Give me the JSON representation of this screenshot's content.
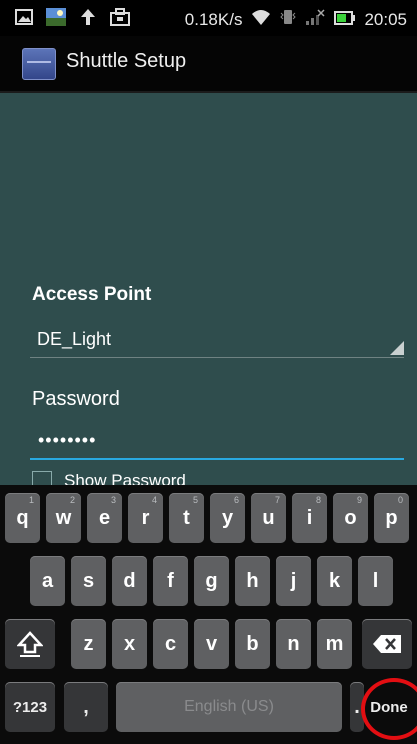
{
  "status_bar": {
    "speed": "0.18K/s",
    "time": "20:05",
    "left_icons": [
      "image-icon",
      "photo-icon",
      "upload-arrow-icon",
      "bag-icon"
    ],
    "right_icons": [
      "wifi-icon",
      "vibrate-icon",
      "signal-icon",
      "battery-icon"
    ]
  },
  "app": {
    "title": "Shuttle Setup",
    "icon": "shuttle-app-icon"
  },
  "form": {
    "access_point_label": "Access Point",
    "access_point_value": "DE_Light",
    "password_label": "Password",
    "password_value": "••••••••",
    "show_password_label": "Show Password",
    "show_password_checked": false
  },
  "keyboard": {
    "row1": [
      {
        "key": "q",
        "hint": "1"
      },
      {
        "key": "w",
        "hint": "2"
      },
      {
        "key": "e",
        "hint": "3"
      },
      {
        "key": "r",
        "hint": "4"
      },
      {
        "key": "t",
        "hint": "5"
      },
      {
        "key": "y",
        "hint": "6"
      },
      {
        "key": "u",
        "hint": "7"
      },
      {
        "key": "i",
        "hint": "8"
      },
      {
        "key": "o",
        "hint": "9"
      },
      {
        "key": "p",
        "hint": "0"
      }
    ],
    "row2": [
      "a",
      "s",
      "d",
      "f",
      "g",
      "h",
      "j",
      "k",
      "l"
    ],
    "row3": [
      "z",
      "x",
      "c",
      "v",
      "b",
      "n",
      "m"
    ],
    "symbols_key": "?123",
    "comma_key": ",",
    "space_label": "English (US)",
    "period_key": ".",
    "done_key": "Done",
    "shift_icon": "shift-arrow-icon",
    "backspace_icon": "backspace-icon"
  },
  "annotation": {
    "highlight_color": "#e30e12",
    "highlighted_key": "Done"
  }
}
